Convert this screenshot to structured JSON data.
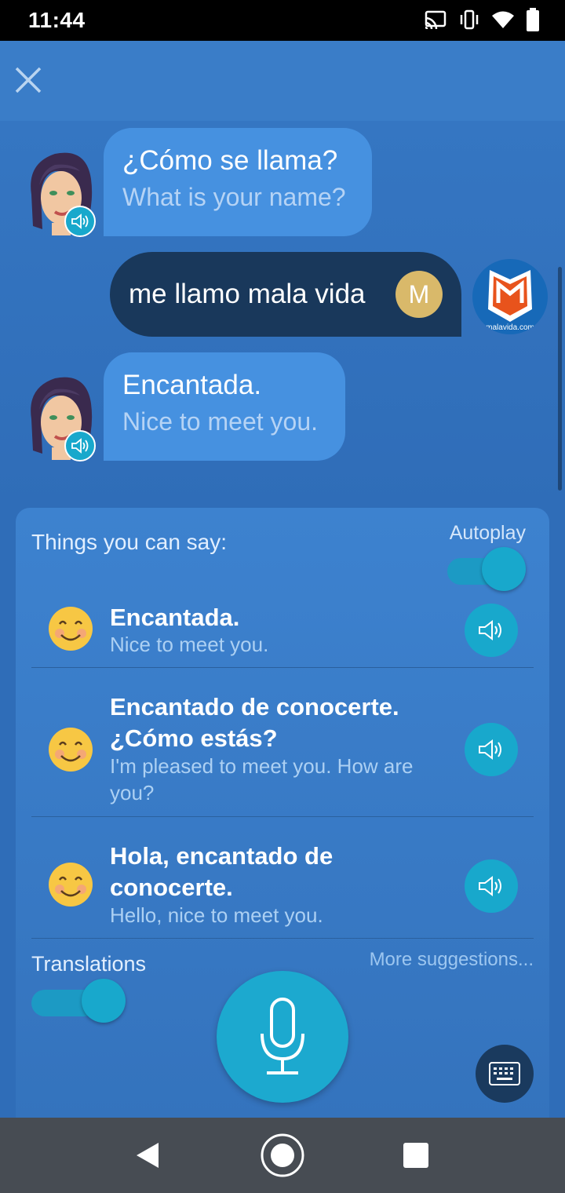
{
  "status_bar": {
    "time": "11:44",
    "icons": [
      "cast-icon",
      "vibrate-icon",
      "wifi-icon",
      "battery-icon"
    ]
  },
  "app_bar": {
    "close_icon": "close-icon"
  },
  "chat": {
    "messages": [
      {
        "sender": "bot",
        "text": "¿Cómo se llama?",
        "translation": "What is your name?"
      },
      {
        "sender": "user",
        "text": "me llamo mala vida",
        "initial": "M",
        "logo_text": "malavida.com"
      },
      {
        "sender": "bot",
        "text": "Encantada.",
        "translation": "Nice to meet you."
      }
    ]
  },
  "panel": {
    "title": "Things you can say:",
    "autoplay_label": "Autoplay",
    "autoplay_on": true,
    "suggestions": [
      {
        "text": "Encantada.",
        "translation": "Nice to meet you."
      },
      {
        "text": "Encantado de conocerte. ¿Cómo estás?",
        "translation": "I'm pleased to meet you. How are you?"
      },
      {
        "text": "Hola, encantado de conocerte.",
        "translation": "Hello, nice to meet you."
      }
    ],
    "translations_label": "Translations",
    "translations_on": true,
    "more_suggestions": "More suggestions..."
  },
  "colors": {
    "accent": "#18a8cc",
    "background": "#2f6db8",
    "user_bubble": "#19385b",
    "bot_bubble": "#4691e0"
  }
}
